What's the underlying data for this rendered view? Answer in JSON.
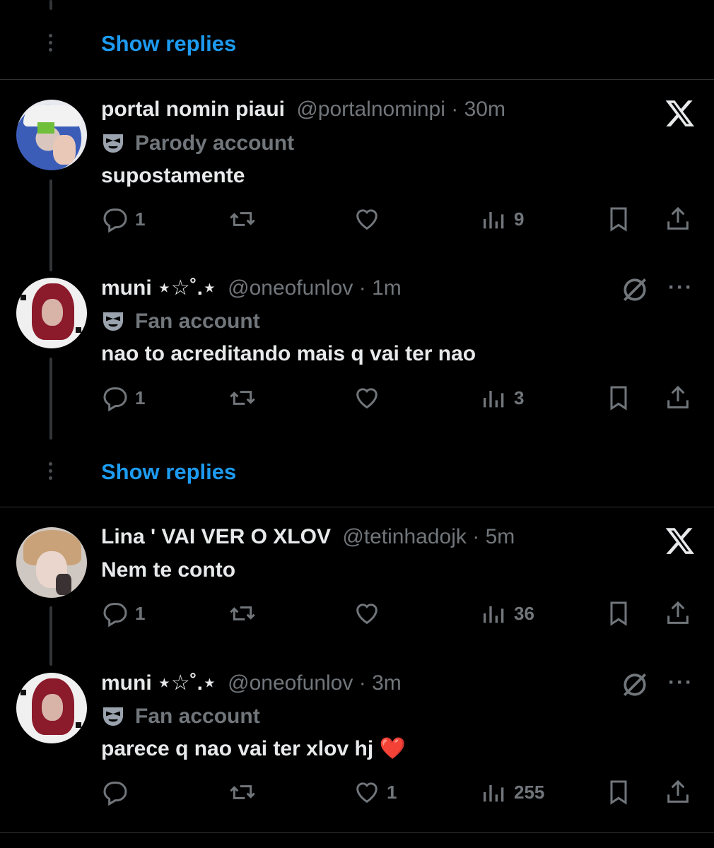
{
  "show_replies_label": "Show replies",
  "threads": [
    {
      "post": {
        "name": "portal nomin piaui",
        "handle": "@portalnominpi",
        "sep": "·",
        "time": "30m",
        "badge": "Parody account",
        "text": "supostamente",
        "replies": "1",
        "reposts": "",
        "likes": "",
        "views": "9"
      },
      "reply": {
        "name": "muni ⋆☆˚.⋆",
        "handle": "@oneofunlov",
        "sep": "·",
        "time": "1m",
        "badge": "Fan account",
        "text": "nao to acreditando mais q vai ter nao",
        "replies": "1",
        "reposts": "",
        "likes": "",
        "views": "3"
      }
    },
    {
      "post": {
        "name": "Lina ' VAI VER O XLOV",
        "handle": "@tetinhadojk",
        "sep": "·",
        "time": "5m",
        "text": "Nem te conto",
        "replies": "1",
        "reposts": "",
        "likes": "",
        "views": "36"
      },
      "reply": {
        "name": "muni ⋆☆˚.⋆",
        "handle": "@oneofunlov",
        "sep": "·",
        "time": "3m",
        "badge": "Fan account",
        "text": "parece q nao vai ter xlov hj ❤️",
        "replies": "",
        "reposts": "",
        "likes": "1",
        "views": "255"
      }
    }
  ],
  "more_label": "···",
  "colors": {
    "background": "#000000",
    "accent": "#1d9bf0",
    "muted": "#71767b",
    "text": "#e7e9ea",
    "divider": "#2f3336"
  },
  "icons": [
    "reply-icon",
    "repost-icon",
    "like-icon",
    "views-icon",
    "bookmark-icon",
    "share-icon",
    "x-logo-icon",
    "muted-slash-icon",
    "more-icon",
    "mask-icon"
  ]
}
